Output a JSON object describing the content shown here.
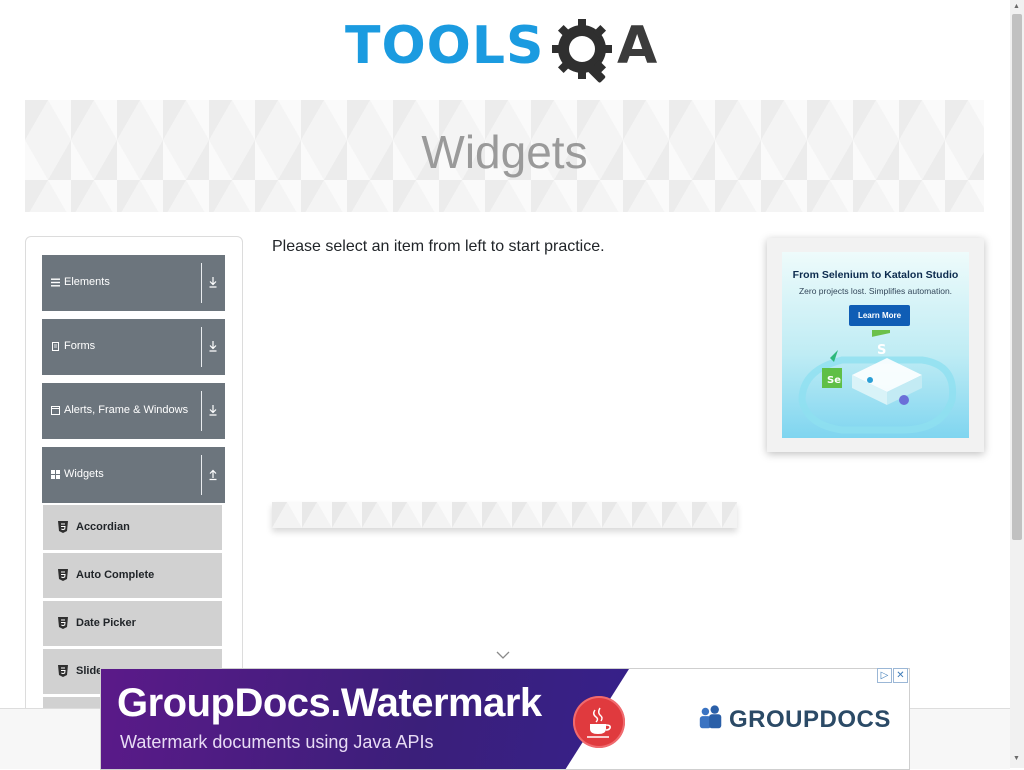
{
  "header": {
    "logo_tools": "TOOLS",
    "logo_a": "A"
  },
  "banner": {
    "title": "Widgets"
  },
  "sidebar": {
    "groups": [
      {
        "label": "Elements",
        "icon": "hamburger-icon",
        "arrow": "download-arrow-icon"
      },
      {
        "label": "Forms",
        "icon": "document-icon",
        "arrow": "download-arrow-icon"
      },
      {
        "label": "Alerts, Frame & Windows",
        "icon": "window-icon",
        "arrow": "download-arrow-icon"
      },
      {
        "label": "Widgets",
        "icon": "grid-icon",
        "arrow": "upload-arrow-icon"
      }
    ],
    "widget_items": [
      {
        "label": "Accordian"
      },
      {
        "label": "Auto Complete"
      },
      {
        "label": "Date Picker"
      },
      {
        "label": "Slider"
      }
    ]
  },
  "main": {
    "message": "Please select an item from left to start practice."
  },
  "ad_right": {
    "title": "From Selenium to Katalon Studio",
    "subtitle": "Zero projects lost. Simplifies automation.",
    "button": "Learn More"
  },
  "ad_bottom": {
    "title": "GroupDocs.Watermark",
    "subtitle": "Watermark documents using Java APIs",
    "brand": "GROUPDOCS"
  },
  "colors": {
    "accent_blue": "#1b9be0",
    "sidebar_group": "#6c757d",
    "sidebar_item": "#d1d1d1",
    "ad_purple": "#5b1a89"
  }
}
